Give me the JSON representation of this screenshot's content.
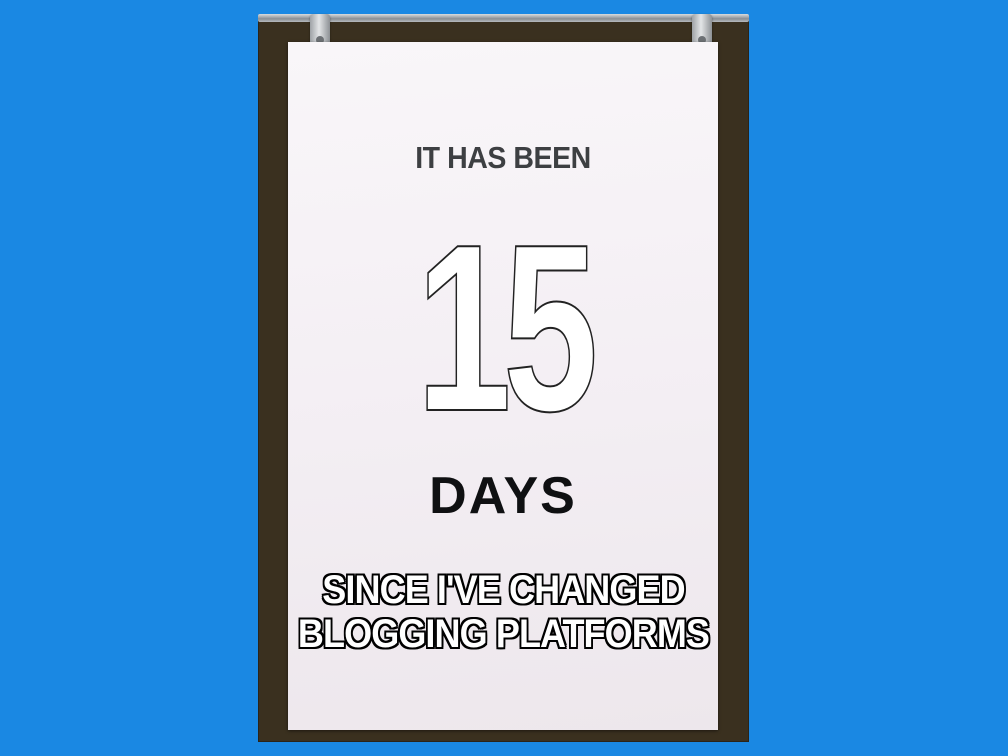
{
  "sign": {
    "line1": "IT HAS BEEN",
    "number": "15",
    "line2": "DAYS"
  },
  "caption": {
    "line1": "SINCE I'VE CHANGED",
    "line2": "BLOGGING PLATFORMS"
  },
  "colors": {
    "background": "#1a88e3",
    "board": "#3a301f",
    "poster": "#f5f1f5"
  }
}
